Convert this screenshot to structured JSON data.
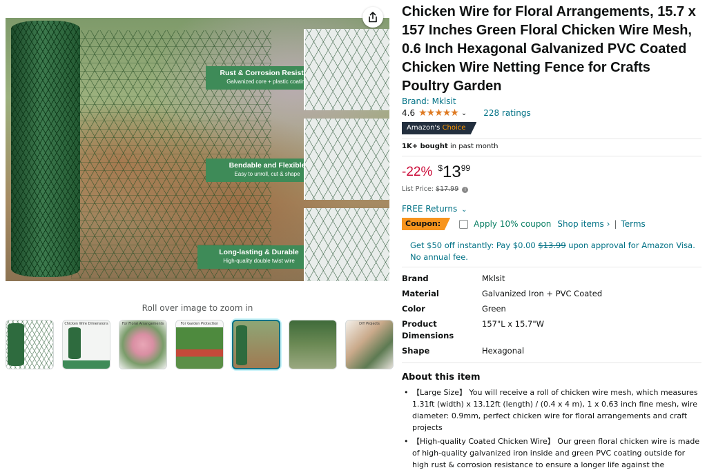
{
  "gallery": {
    "feature_tags": [
      {
        "title": "Rust & Corrosion Resistant",
        "subtitle": "Galvanized core + plastic coating"
      },
      {
        "title": "Bendable and Flexible",
        "subtitle": "Easy to unroll, cut & shape"
      },
      {
        "title": "Long-lasting & Durable",
        "subtitle": "High-quality double twist wire"
      }
    ],
    "zoom_hint": "Roll over image to zoom in",
    "thumb_labels": [
      "",
      "Chicken Wire Dimensions",
      "For Floral Arrangements",
      "For Garden Protection",
      "",
      "",
      "DIY Projects"
    ],
    "share_icon": "share-icon"
  },
  "product": {
    "title": "Chicken Wire for Floral Arrangements, 15.7 x 157 Inches Green Floral Chicken Wire Mesh, 0.6 Inch Hexagonal Galvanized PVC Coated Chicken Wire Netting Fence for Crafts Poultry Garden",
    "brand_link": "Brand: Mklsit",
    "rating_value": "4.6",
    "stars": "★★★★★",
    "ratings_count": "228 ratings",
    "badge_main": "Amazon's",
    "badge_accent": "Choice",
    "bought_bold": "1K+ bought",
    "bought_rest": " in past month",
    "discount": "-22%",
    "price_symbol": "$",
    "price_whole": "13",
    "price_fraction": "99",
    "list_price_label": "List Price: ",
    "list_price": "$17.99",
    "free_returns": "FREE Returns",
    "coupon_label": "Coupon:",
    "coupon_apply": "Apply 10% coupon",
    "shop_items": "Shop items ›",
    "pipe": "|",
    "terms": "Terms",
    "visa_text_1": "Get $50 off instantly: Pay $0.00 ",
    "visa_strike": "$13.99",
    "visa_text_2": " upon approval for Amazon Visa. No annual fee."
  },
  "specs": [
    {
      "key": "Brand",
      "value": "Mklsit"
    },
    {
      "key": "Material",
      "value": "Galvanized Iron + PVC Coated"
    },
    {
      "key": "Color",
      "value": "Green"
    },
    {
      "key": "Product Dimensions",
      "value": "157\"L x 15.7\"W"
    },
    {
      "key": "Shape",
      "value": "Hexagonal"
    }
  ],
  "about": {
    "title": "About this item",
    "bullets": [
      "【Large Size】 You will receive a roll of chicken wire mesh, which measures 1.31ft (width) x 13.12ft (length) / (0.4 x 4 m), 1 x 0.63 inch fine mesh, wire diameter: 0.9mm, perfect chicken wire for floral arrangements and craft projects",
      "【High-quality Coated Chicken Wire】 Our green floral chicken wire is made of high-quality galvanized iron inside and green PVC coating outside for high rust & corrosion resistance to ensure a longer life against the elements."
    ]
  },
  "colors": {
    "link": "#007185",
    "discount": "#cc0c39",
    "star": "#de7921",
    "coupon": "#f7941d",
    "badge_bg": "#232f3e",
    "badge_accent": "#ff9900",
    "feature_green": "#3e8b58"
  }
}
